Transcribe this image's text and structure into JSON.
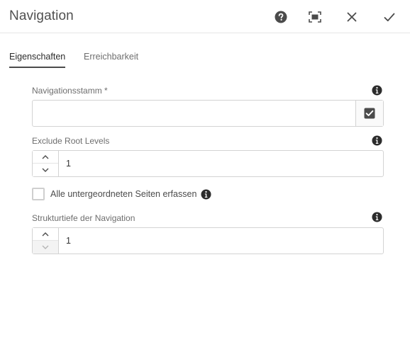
{
  "dialog": {
    "title": "Navigation",
    "help_icon": "help-circle-icon",
    "fullscreen_icon": "fullscreen-icon",
    "close_icon": "close-icon",
    "done_icon": "checkmark-icon"
  },
  "tabs": [
    {
      "label": "Eigenschaften",
      "active": true
    },
    {
      "label": "Erreichbarkeit",
      "active": false
    }
  ],
  "form": {
    "navigation_root": {
      "label": "Navigationsstamm *",
      "value": "",
      "picker_icon": "checkbox-picker-icon"
    },
    "exclude_root_levels": {
      "label": "Exclude Root Levels",
      "value": "1"
    },
    "collect_all_child_pages": {
      "label": "Alle untergeordneten Seiten erfassen",
      "checked": false
    },
    "structure_depth": {
      "label": "Strukturtiefe der Navigation",
      "value": "1"
    }
  },
  "colors": {
    "text": "#4b4b4b",
    "border": "#d3d3d3",
    "icon": "#323232"
  }
}
